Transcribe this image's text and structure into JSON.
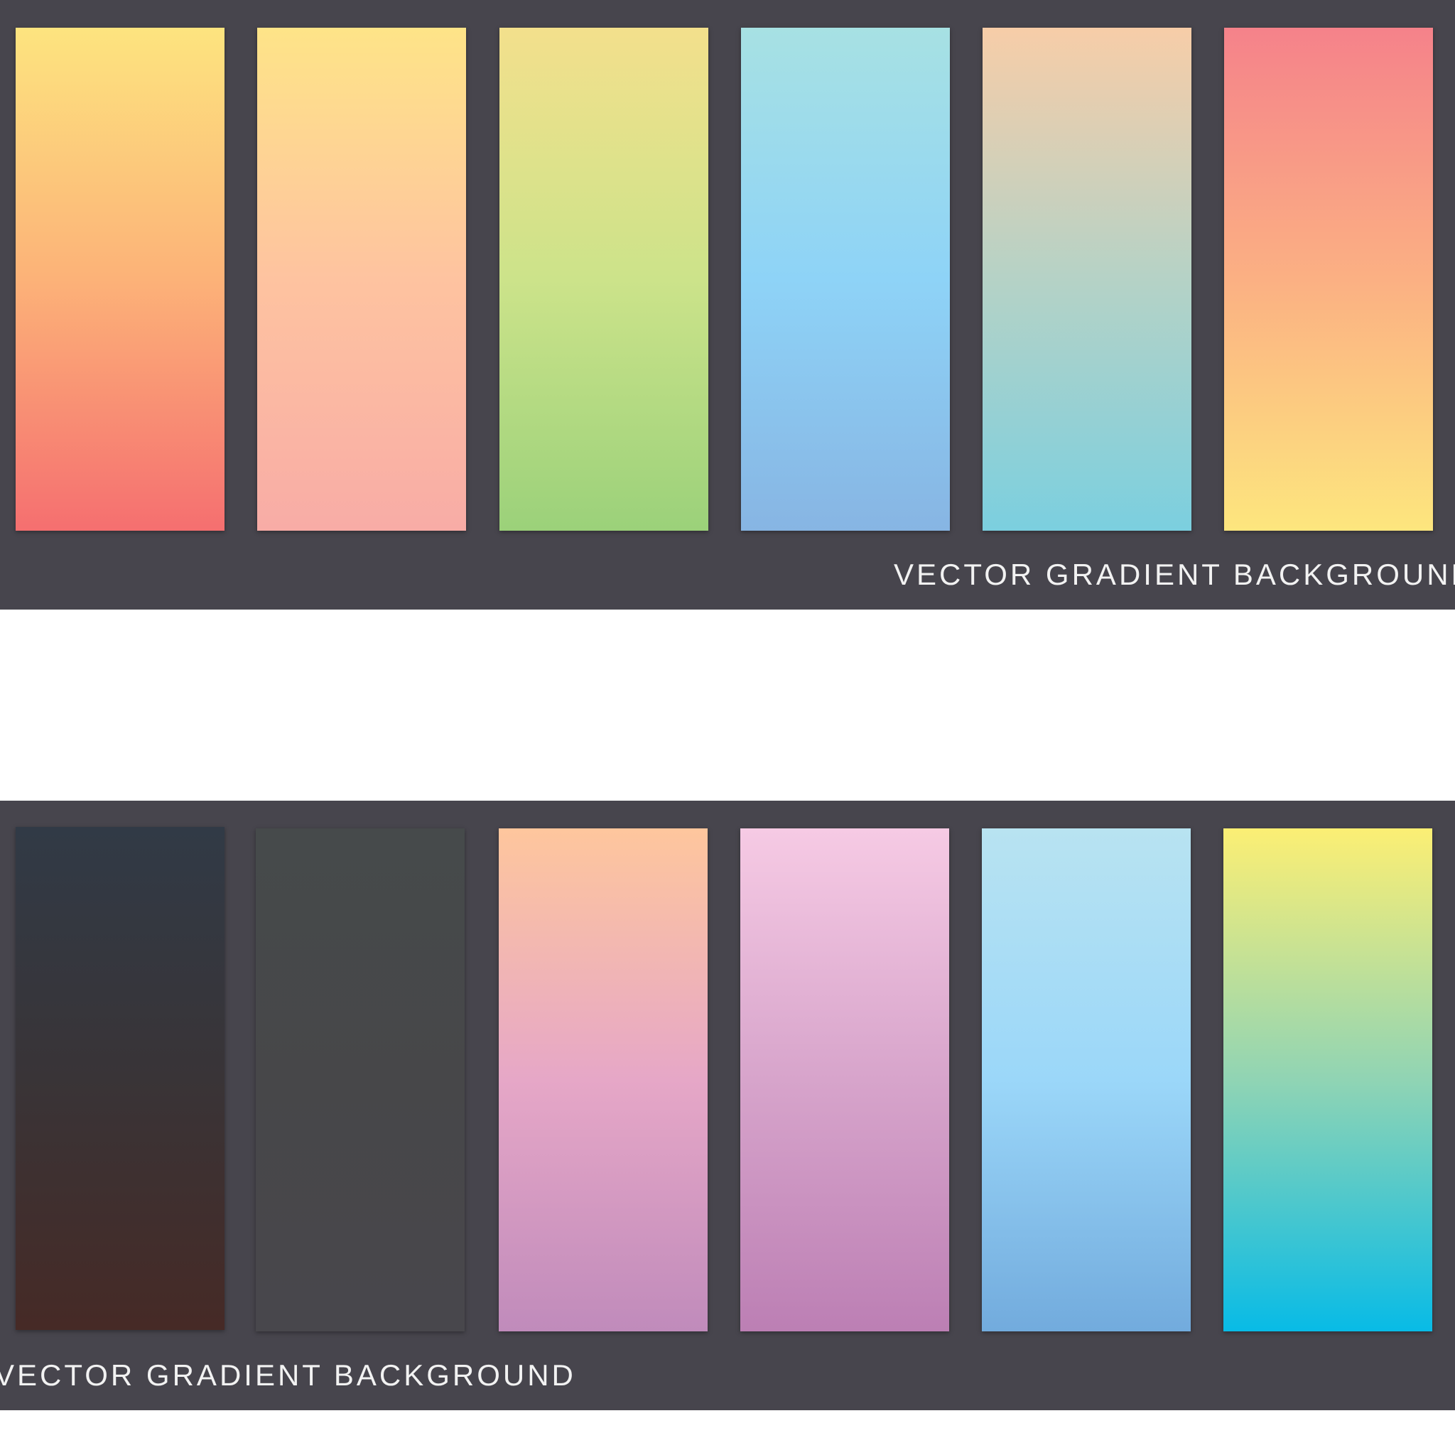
{
  "panels": [
    {
      "label": "VECTOR GRADIENT BACKGROUND",
      "swatches": [
        {
          "stops": [
            "#fde47f",
            "#fcb278",
            "#f56f70"
          ]
        },
        {
          "stops": [
            "#fee488",
            "#fec3a0",
            "#f8aca6"
          ]
        },
        {
          "stops": [
            "#f3e08c",
            "#cce38a",
            "#9bd17a"
          ]
        },
        {
          "stops": [
            "#a7e1e3",
            "#8ed3f7",
            "#87b5e3"
          ]
        },
        {
          "stops": [
            "#f7cda8",
            "#b5d2c6",
            "#7bcfdf"
          ]
        },
        {
          "stops": [
            "#f5828a",
            "#fbb083",
            "#fde67e"
          ]
        }
      ]
    },
    {
      "label": "VECTOR GRADIENT BACKGROUND",
      "swatches": [
        {
          "stops": [
            "#313a46",
            "#393437",
            "#462a26"
          ]
        },
        {
          "stops": [
            "#464a4b",
            "#474749",
            "#48474c"
          ]
        },
        {
          "stops": [
            "#fec69d",
            "#e6a7c7",
            "#c08bbb"
          ]
        },
        {
          "stops": [
            "#f6cae4",
            "#d7a4cb",
            "#bc7fb4"
          ]
        },
        {
          "stops": [
            "#b8e3f1",
            "#9bd7f9",
            "#72abdd"
          ]
        },
        {
          "stops": [
            "#fcef74",
            "#90d4b4",
            "#08bbe6"
          ]
        }
      ]
    }
  ]
}
